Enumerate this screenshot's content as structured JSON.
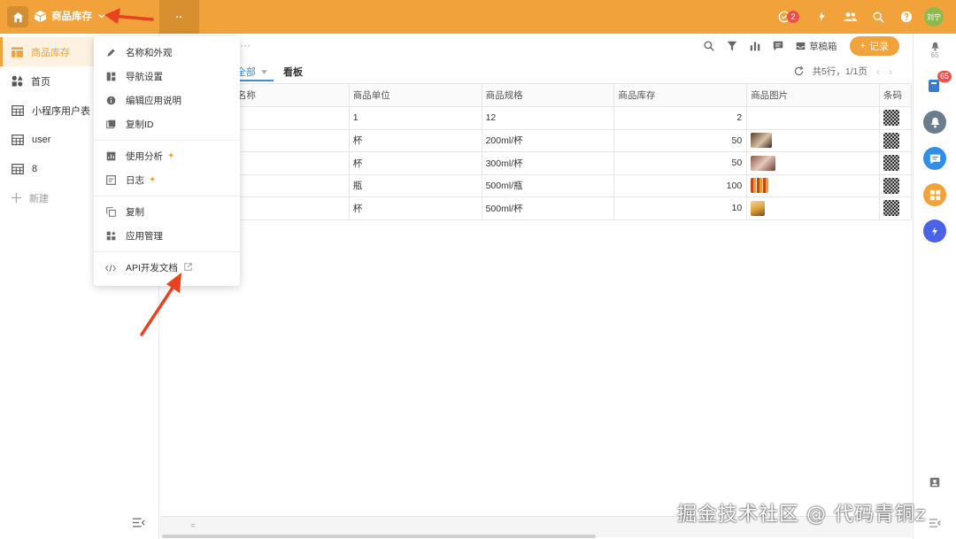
{
  "topbar": {
    "app_name": "商品库存",
    "more": "··",
    "todo_count": "2",
    "avatar": "刘宁"
  },
  "sidebar": {
    "items": [
      {
        "label": "商品库存"
      },
      {
        "label": "首页"
      },
      {
        "label": "小程序用户表"
      },
      {
        "label": "user"
      },
      {
        "label": "8"
      }
    ],
    "new_label": "新建"
  },
  "toolbar": {
    "dots": "···",
    "draft_label": "草稿箱",
    "add_label": "记录"
  },
  "tabs": {
    "all": "全部",
    "board": "看板"
  },
  "pager": {
    "summary": "共5行，1/1页"
  },
  "table": {
    "headers": [
      "名称",
      "商品单位",
      "商品规格",
      "商品库存",
      "商品图片",
      "条码"
    ],
    "rows": [
      {
        "unit": "1",
        "spec": "12",
        "stock": "2",
        "image": "",
        "has_qr": true
      },
      {
        "unit": "杯",
        "spec": "200ml/杯",
        "stock": "50",
        "image": "milk-tea",
        "has_qr": true
      },
      {
        "unit": "杯",
        "spec": "300ml/杯",
        "stock": "50",
        "image": "cup-drink",
        "has_qr": true
      },
      {
        "unit": "瓶",
        "spec": "500ml/瓶",
        "stock": "100",
        "image": "bottles",
        "has_qr": true
      },
      {
        "unit": "杯",
        "spec": "500ml/杯",
        "stock": "10",
        "image": "juice",
        "has_qr": true
      }
    ]
  },
  "menu": {
    "items": [
      {
        "label": "名称和外观",
        "icon": "pencil-icon"
      },
      {
        "label": "导航设置",
        "icon": "layout-icon"
      },
      {
        "label": "编辑应用说明",
        "icon": "info-icon"
      },
      {
        "label": "复制ID",
        "icon": "id-icon"
      },
      {
        "label": "使用分析",
        "icon": "chart-icon"
      },
      {
        "label": "日志",
        "icon": "log-icon"
      },
      {
        "label": "复制",
        "icon": "copy-icon"
      },
      {
        "label": "应用管理",
        "icon": "apps-icon"
      },
      {
        "label": "API开发文档",
        "icon": "code-icon"
      }
    ]
  },
  "rail": {
    "notify_count": "65",
    "badge_count": "65"
  },
  "watermark": "掘金技术社区 @ 代码青铜z",
  "colors": {
    "accent": "#f1a23a",
    "link": "#3a8fd8",
    "badge": "#e8514e"
  }
}
